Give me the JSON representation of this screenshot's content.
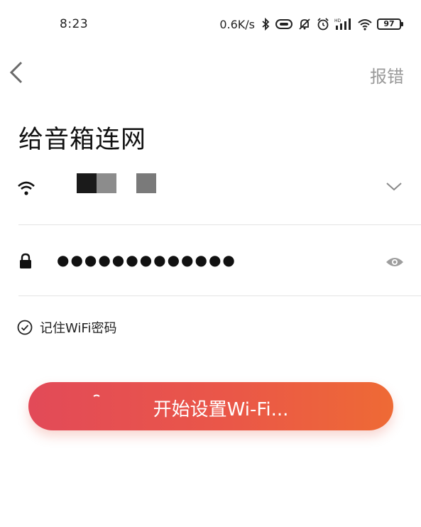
{
  "status_bar": {
    "time": "8:23",
    "net_speed": "0.6K/s",
    "battery": "97",
    "icons": [
      "bluetooth-icon",
      "headset-icon",
      "mute-icon",
      "alarm-icon",
      "hd-signal-icon",
      "wifi-icon",
      "battery-icon"
    ]
  },
  "nav": {
    "back_icon": "chevron-left-icon",
    "report_label": "报错"
  },
  "page": {
    "title": "给音箱连网"
  },
  "wifi": {
    "ssid_redacted": true,
    "icon": "wifi-icon",
    "dropdown_icon": "chevron-down-icon"
  },
  "password": {
    "masked_value": "●●●●●●●●●●●●●",
    "icon": "lock-icon",
    "toggle_icon": "eye-icon"
  },
  "remember": {
    "label": "记住WiFi密码",
    "checked": true
  },
  "start_button": {
    "label": "开始设置Wi-Fi...",
    "gradient_start": "#e24a58",
    "gradient_end": "#ee6a35"
  }
}
